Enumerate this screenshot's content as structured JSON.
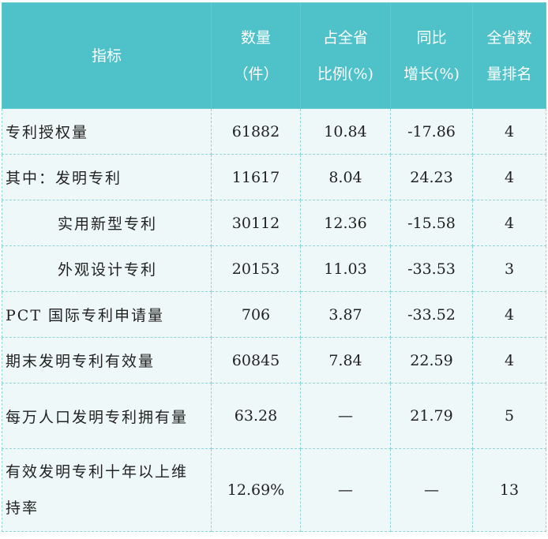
{
  "table": {
    "headers": [
      [
        "指标"
      ],
      [
        "数量",
        "（件）"
      ],
      [
        "占全省",
        "比例(%)"
      ],
      [
        "同比",
        "增长(%)"
      ],
      [
        "全省数",
        "量排名"
      ]
    ],
    "rows": [
      {
        "label": "专利授权量",
        "count": "61882",
        "share": "10.84",
        "growth": "-17.86",
        "rank": "4"
      },
      {
        "label": "其中：发明专利",
        "count": "11617",
        "share": "8.04",
        "growth": "24.23",
        "rank": "4"
      },
      {
        "label": "实用新型专利",
        "count": "30112",
        "share": "12.36",
        "growth": "-15.58",
        "rank": "4"
      },
      {
        "label": "外观设计专利",
        "count": "20153",
        "share": "11.03",
        "growth": "-33.53",
        "rank": "3"
      },
      {
        "label": "PCT 国际专利申请量",
        "count": "706",
        "share": "3.87",
        "growth": "-33.52",
        "rank": "4"
      },
      {
        "label": "期末发明专利有效量",
        "count": "60845",
        "share": "7.84",
        "growth": "22.59",
        "rank": "4"
      },
      {
        "label": "每万人口发明专利拥有量",
        "count": "63.28",
        "share": "—",
        "growth": "21.79",
        "rank": "5"
      },
      {
        "label_lines": [
          "有效发明专利十年以上维",
          "持率"
        ],
        "count": "12.69%",
        "share": "—",
        "growth": "—",
        "rank": "13"
      }
    ]
  }
}
